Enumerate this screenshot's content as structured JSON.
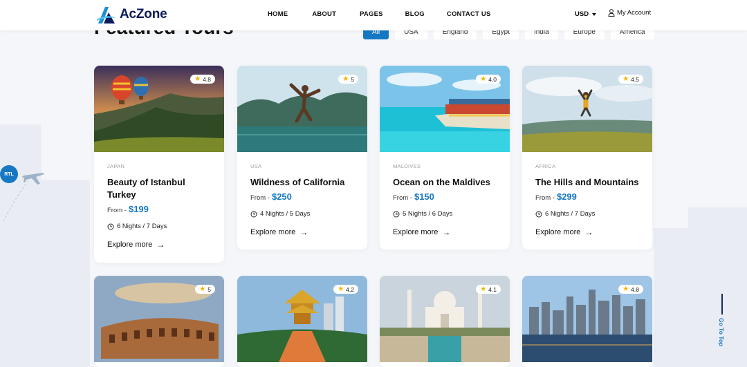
{
  "header": {
    "logo_text": "AcZone",
    "nav": [
      "HOME",
      "ABOUT",
      "PAGES",
      "BLOG",
      "CONTACT US"
    ],
    "currency": "USD",
    "account": "My Account"
  },
  "section": {
    "title": "Featured Tours",
    "filters": [
      "All",
      "USA",
      "England",
      "Egypt",
      "India",
      "Europe",
      "America"
    ]
  },
  "tours": [
    {
      "country": "JAPAN",
      "name": "Beauty of Istanbul Turkey",
      "from": "From -",
      "price": "$199",
      "duration": "6 Nights / 7 Days",
      "rating": "4.8",
      "cta": "Explore more"
    },
    {
      "country": "USA",
      "name": "Wildness of California",
      "from": "From -",
      "price": "$250",
      "duration": "4 Nights / 5 Days",
      "rating": "5",
      "cta": "Explore more"
    },
    {
      "country": "MALDIVES",
      "name": "Ocean on the Maldives",
      "from": "From -",
      "price": "$150",
      "duration": "5 Nights / 6 Days",
      "rating": "4.0",
      "cta": "Explore more"
    },
    {
      "country": "AFRICA",
      "name": "The Hills and Mountains",
      "from": "From -",
      "price": "$299",
      "duration": "6 Nights / 7 Days",
      "rating": "4.5",
      "cta": "Explore more"
    },
    {
      "rating": "5"
    },
    {
      "rating": "4.2"
    },
    {
      "rating": "4.1"
    },
    {
      "rating": "4.8"
    }
  ],
  "widgets": {
    "rtl": "RTL",
    "go_to_top": "Go To Top"
  },
  "colors": {
    "accent": "#1678c2",
    "logo_dark": "#0b1b5b",
    "star": "#f5b400"
  }
}
